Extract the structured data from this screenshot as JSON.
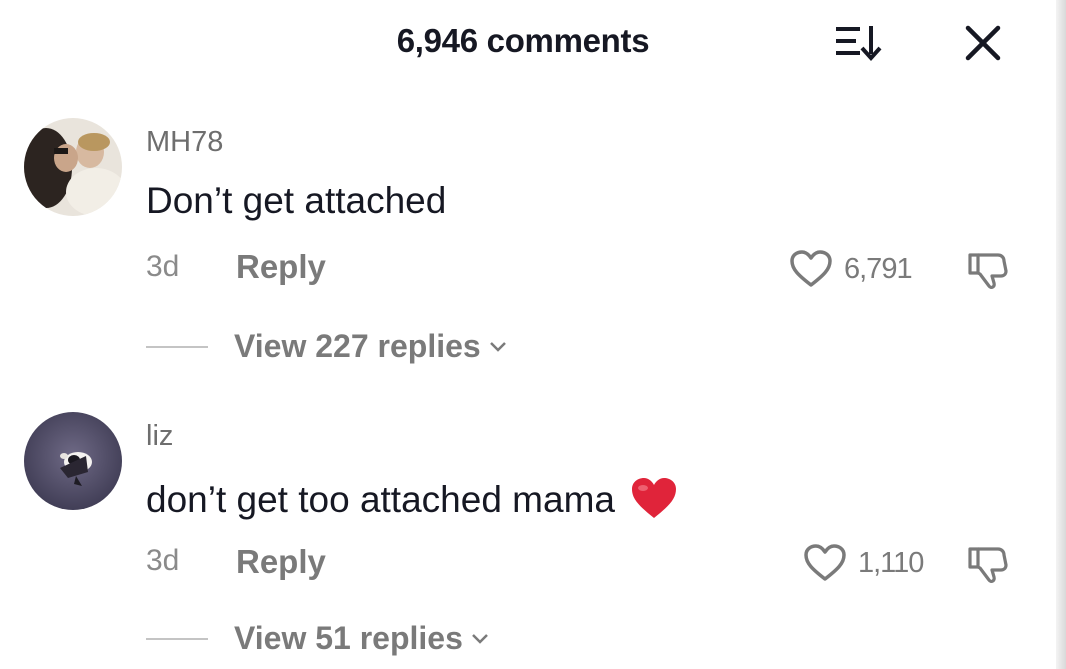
{
  "header": {
    "title": "6,946 comments",
    "sort_icon": "sort-icon",
    "close_icon": "close-icon"
  },
  "comments": [
    {
      "username": "MH78",
      "text": "Don’t get attached",
      "age": "3d",
      "reply_label": "Reply",
      "likes": "6,791",
      "view_replies": "View 227 replies"
    },
    {
      "username": "liz",
      "text": "don’t get too attached mama",
      "emoji": "red-heart-emoji",
      "age": "3d",
      "reply_label": "Reply",
      "likes": "1,110",
      "view_replies": "View 51 replies"
    }
  ],
  "colors": {
    "text": "#161823",
    "muted": "#7a7a7a",
    "heart": "#e0243a"
  }
}
